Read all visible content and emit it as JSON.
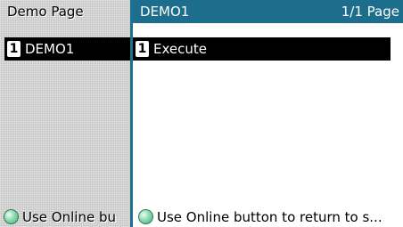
{
  "left_panel": {
    "title": "Demo Page",
    "item": {
      "number": "1",
      "label": "DEMO1"
    },
    "footer_text": "Use Online bu"
  },
  "right_panel": {
    "title": "DEMO1",
    "page_info": "1/1 Page",
    "item": {
      "number": "1",
      "label": "Execute"
    },
    "footer_text": "Use Online button to return to s..."
  },
  "colors": {
    "header_bg": "#1d6e8c",
    "selected_bg": "#000000",
    "left_bg": "#bdbdbd",
    "led": "#8fd9b0"
  },
  "icons": {
    "footer_icon": "online-led-icon"
  }
}
